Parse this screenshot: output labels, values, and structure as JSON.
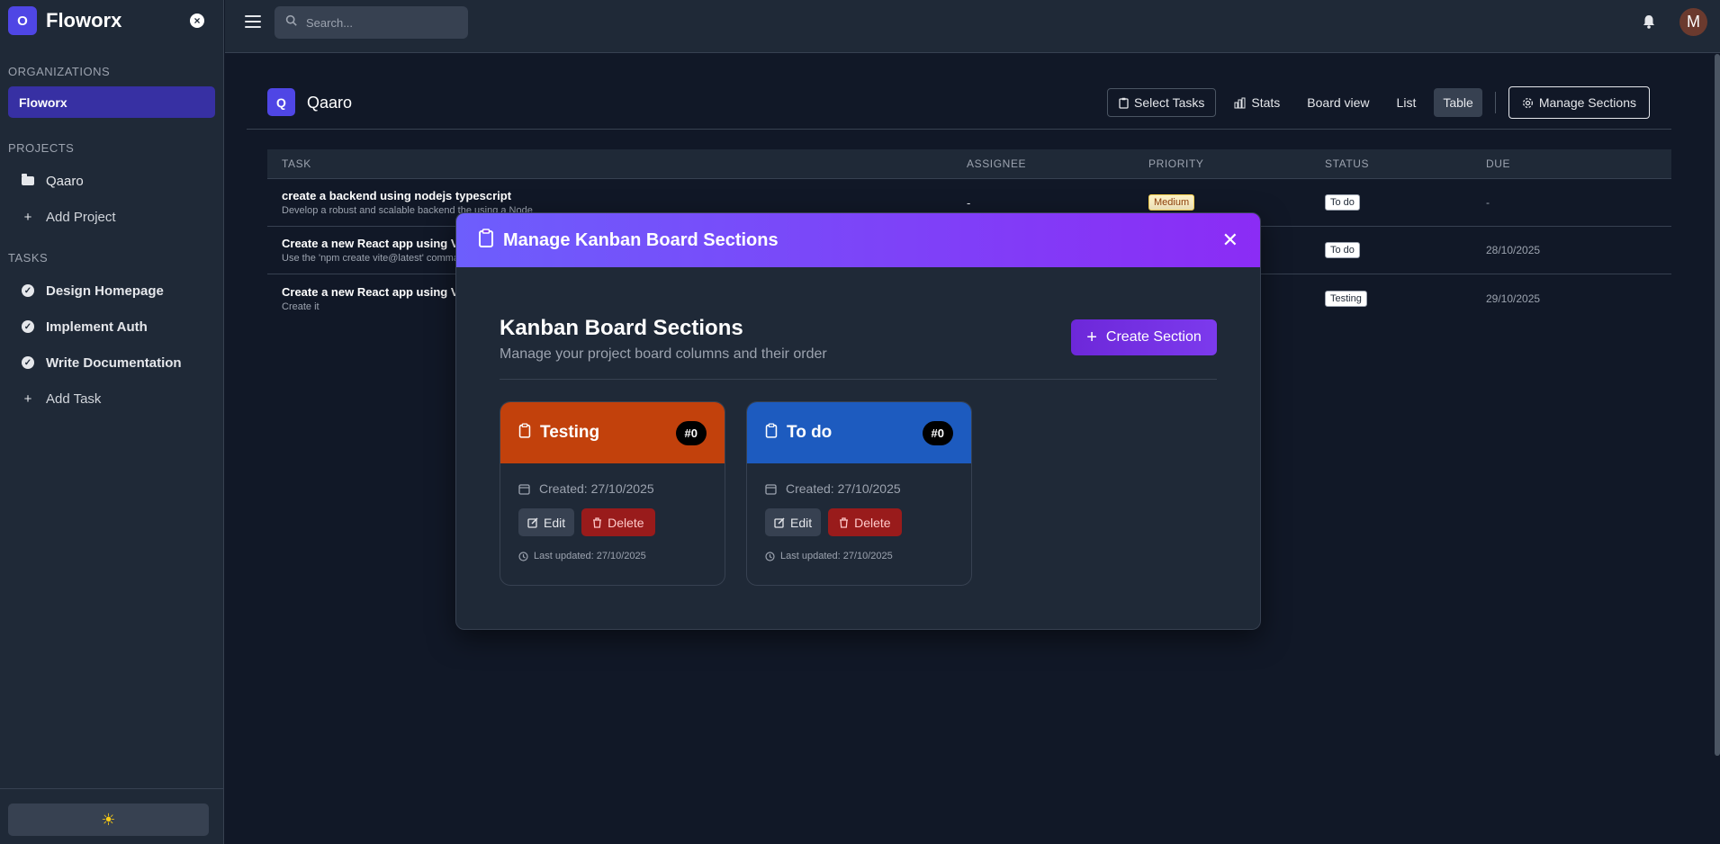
{
  "sidebar": {
    "brand_initial": "O",
    "brand_name": "Floworx",
    "organizations_heading": "ORGANIZATIONS",
    "organization": "Floworx",
    "projects_heading": "PROJECTS",
    "projects": [
      {
        "label": "Qaaro"
      }
    ],
    "add_project": "Add Project",
    "tasks_heading": "TASKS",
    "tasks": [
      {
        "label": "Design Homepage"
      },
      {
        "label": "Implement Auth"
      },
      {
        "label": "Write Documentation"
      }
    ],
    "add_task": "Add Task",
    "theme_icon": "sun-icon"
  },
  "topbar": {
    "search_placeholder": "Search...",
    "avatar_initial": "M"
  },
  "project": {
    "initial": "Q",
    "name": "Qaaro",
    "buttons": {
      "select_tasks": "Select Tasks",
      "stats": "Stats",
      "board_view": "Board view",
      "list": "List",
      "table": "Table",
      "manage_sections": "Manage Sections"
    },
    "active_view": "Table"
  },
  "table": {
    "headers": [
      "TASK",
      "ASSIGNEE",
      "PRIORITY",
      "STATUS",
      "DUE"
    ],
    "rows": [
      {
        "title": "create a backend using nodejs typescript",
        "desc": "Develop a robust and scalable backend the using a Node",
        "assignee": "-",
        "priority": "Medium",
        "status": "To do",
        "due": "-"
      },
      {
        "title": "Create a new React app using Vite",
        "desc": "Use the 'npm create vite@latest' command",
        "assignee": "",
        "priority": "",
        "status": "To do",
        "due": "28/10/2025"
      },
      {
        "title": "Create a new React app using Vite",
        "desc": "Create it",
        "assignee": "",
        "priority": "",
        "status": "Testing",
        "due": "29/10/2025"
      }
    ]
  },
  "modal": {
    "title": "Manage Kanban Board Sections",
    "heading": "Kanban Board Sections",
    "subheading": "Manage your project board columns and their order",
    "create_button": "Create Section",
    "sections": [
      {
        "name": "Testing",
        "number": "#0",
        "created": "Created: 27/10/2025",
        "edit": "Edit",
        "delete": "Delete",
        "updated": "Last updated: 27/10/2025",
        "color": "#c2410c"
      },
      {
        "name": "To do",
        "number": "#0",
        "created": "Created: 27/10/2025",
        "edit": "Edit",
        "delete": "Delete",
        "updated": "Last updated: 27/10/2025",
        "color": "#1d5bbf"
      }
    ]
  },
  "colors": {
    "accent": "#4f46e5",
    "modal_gradient_start": "#6d5efc",
    "modal_gradient_end": "#8b2cf5",
    "background": "#111827",
    "surface": "#1f2937"
  }
}
